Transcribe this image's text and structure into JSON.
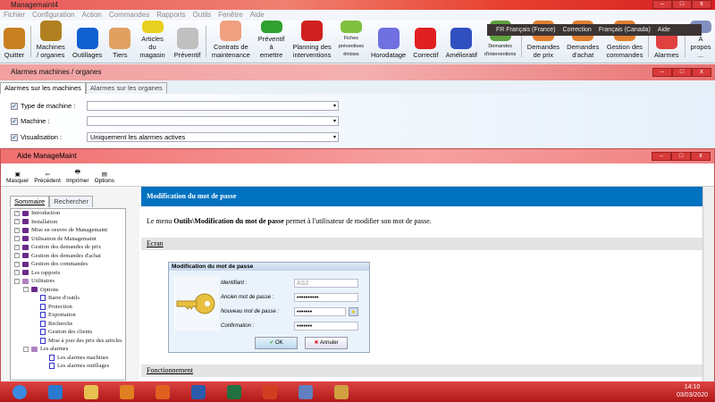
{
  "app": {
    "title": "Managemaint4"
  },
  "menu": [
    "Fichier",
    "Configuration",
    "Action",
    "Commandes",
    "Rapports",
    "Outils",
    "Fenêtre",
    "Aide"
  ],
  "toolbar": [
    {
      "label": "Quitter",
      "icon": "exit-door-icon",
      "color": "#c88020"
    },
    {
      "label": "Machines / organes",
      "icon": "gears-icon",
      "color": "#b08020"
    },
    {
      "label": "Outillages",
      "icon": "wrench-icon",
      "color": "#1060d0"
    },
    {
      "label": "Tiers",
      "icon": "person-icon",
      "color": "#e0a060"
    },
    {
      "label": "Articles du magasin",
      "icon": "screwdriver-icon",
      "color": "#e8d020"
    },
    {
      "label": "Préventif",
      "icon": "syringe-icon",
      "color": "#c0c0c0"
    },
    {
      "label": "Contrats de maintenance",
      "icon": "contract-icon",
      "color": "#f0a080"
    },
    {
      "label": "Préventif à emettre",
      "icon": "preventive-add-icon",
      "color": "#30a030"
    },
    {
      "label": "Planning des interventions",
      "icon": "calendar-icon",
      "color": "#d02020"
    },
    {
      "label": "Fiches préventives émises",
      "icon": "syringe-check-icon",
      "color": "#80c040"
    },
    {
      "label": "Horodatage",
      "icon": "clock-icon",
      "color": "#7070e0"
    },
    {
      "label": "Correctif",
      "icon": "first-aid-icon",
      "color": "#e02020"
    },
    {
      "label": "Amélioratif",
      "icon": "chart-icon",
      "color": "#3050c0"
    },
    {
      "label": "Demandes d'interventions",
      "icon": "globe-icon",
      "color": "#60a040"
    },
    {
      "label": "Demandes de prix",
      "icon": "pen-doc-icon",
      "color": "#e08030"
    },
    {
      "label": "Demandes d'achat",
      "icon": "pen-doc-icon",
      "color": "#e08030"
    },
    {
      "label": "Gestion des commandes",
      "icon": "pen-doc-icon",
      "color": "#e08030"
    },
    {
      "label": "Alarmes",
      "icon": "alarm-icon",
      "color": "#e04040"
    },
    {
      "label": "A propos ...",
      "icon": "info-icon",
      "color": "#8090c0"
    }
  ],
  "langbar": {
    "input": "FR Français (France)",
    "correction": "Correction",
    "keyboard": "Français (Canada)",
    "help": "Aide"
  },
  "child": {
    "title": "Alarmes machines / organes",
    "tabs": [
      "Alarmes sur les machines",
      "Alarmes sur les organes"
    ],
    "fields": [
      {
        "label": "Type de machine :",
        "value": "",
        "checked": true
      },
      {
        "label": "Machine :",
        "value": "",
        "checked": true
      },
      {
        "label": "Visualisation :",
        "value": "Uniquement les alarmes actives",
        "checked": true
      }
    ]
  },
  "help": {
    "title": "Aide ManageMaint",
    "toolbar": [
      "Masquer",
      "Précédent",
      "Imprimer",
      "Options"
    ],
    "tabs": [
      "Sommaire",
      "Rechercher"
    ],
    "tree": [
      {
        "label": "Introduction",
        "type": "book",
        "level": 0,
        "exp": "+"
      },
      {
        "label": "Installation",
        "type": "book",
        "level": 0,
        "exp": "+"
      },
      {
        "label": "Mise en oeuvre de Managemaint",
        "type": "book",
        "level": 0,
        "exp": "+"
      },
      {
        "label": "Utilisation de Managemaint",
        "type": "book",
        "level": 0,
        "exp": "+"
      },
      {
        "label": "Gestion des demandes de prix",
        "type": "book",
        "level": 0,
        "exp": "+"
      },
      {
        "label": "Gestion des demandes d'achat",
        "type": "book",
        "level": 0,
        "exp": "+"
      },
      {
        "label": "Gestion des commandes",
        "type": "book",
        "level": 0,
        "exp": "+"
      },
      {
        "label": "Les rapports",
        "type": "book",
        "level": 0,
        "exp": "+"
      },
      {
        "label": "Utilitaires",
        "type": "open",
        "level": 0,
        "exp": "-"
      },
      {
        "label": "Options",
        "type": "book",
        "level": 1,
        "exp": "+"
      },
      {
        "label": "Barre d'outils",
        "type": "page",
        "level": 2
      },
      {
        "label": "Protection",
        "type": "page",
        "level": 2
      },
      {
        "label": "Exportation",
        "type": "page",
        "level": 2
      },
      {
        "label": "Recherche",
        "type": "page",
        "level": 2
      },
      {
        "label": "Gestion des clients",
        "type": "page",
        "level": 2
      },
      {
        "label": "Mise à jour des prix des articles",
        "type": "page",
        "level": 2
      },
      {
        "label": "Les alarmes",
        "type": "open",
        "level": 1,
        "exp": "-"
      },
      {
        "label": "Les alarmes machines",
        "type": "page",
        "level": 3
      },
      {
        "label": "Les alarmes outillages",
        "type": "page",
        "level": 3
      }
    ],
    "heading": "Modification du mot de passe",
    "para": {
      "pre": "Le menu ",
      "bold": "Outils\\Modification du mot de passe",
      "post": " permet à l'utilisateur de modifier son mot de passe."
    },
    "section1": "Ecran",
    "section2": "Fonctionnement",
    "dialog": {
      "title": "Modification du mot de passe",
      "labels": [
        "Identifiant :",
        "Ancien mot de passe :",
        "Nouveau mot de passe :",
        "Confirmation :"
      ],
      "values": [
        "AS2",
        "••••••••••",
        "•••••••",
        "•••••••"
      ],
      "ok": "OK",
      "cancel": "Annuler"
    }
  },
  "taskbar": {
    "apps": [
      {
        "icon": "windows-start-icon",
        "color": "#3a8ae0"
      },
      {
        "icon": "ie-icon",
        "color": "#2a7ad0"
      },
      {
        "icon": "folder-icon",
        "color": "#e8c050"
      },
      {
        "icon": "media-player-icon",
        "color": "#e08020"
      },
      {
        "icon": "firefox-icon",
        "color": "#e06020"
      },
      {
        "icon": "word-icon",
        "color": "#2a5aaa"
      },
      {
        "icon": "excel-icon",
        "color": "#207040"
      },
      {
        "icon": "powerpoint-icon",
        "color": "#d04020"
      },
      {
        "icon": "managemaint-icon",
        "color": "#6080c0"
      },
      {
        "icon": "app-icon",
        "color": "#d0a040"
      }
    ],
    "time": "14:10",
    "date": "03/03/2020"
  }
}
